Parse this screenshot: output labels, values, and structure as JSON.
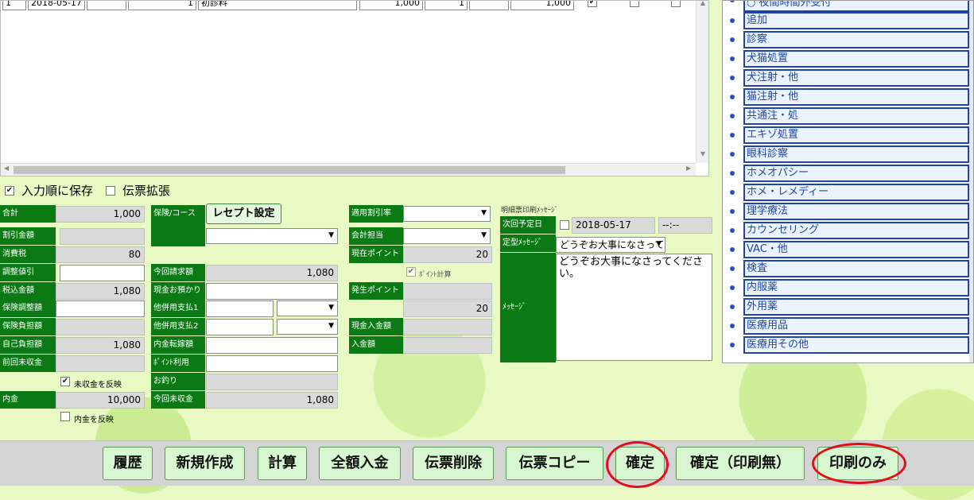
{
  "grid": {
    "row": {
      "no": "1",
      "date": "2018-05-17",
      "code": "",
      "qty": "1",
      "item": "初診料",
      "price": "1,000",
      "count": "1",
      "discount": "",
      "amount": "1,000",
      "check1": true,
      "check2": false,
      "check3": false
    }
  },
  "menu": {
    "top_partial": "○ 夜間時間外受付",
    "items": [
      "追加",
      "診察",
      "犬猫処置",
      "犬注射・他",
      "猫注射・他",
      "共通注・処",
      "エキゾ処置",
      "眼科診察",
      "ホメオパシー",
      "ホメ・レメディー",
      "理学療法",
      "カウンセリング",
      "VAC・他",
      "検査",
      "内服薬",
      "外用薬",
      "医療用品",
      "医療用その他"
    ]
  },
  "options": {
    "save_order_label": "入力順に保存",
    "save_order_checked": true,
    "expand_label": "伝票拡張",
    "expand_checked": false
  },
  "col1": {
    "total_label": "合計",
    "total": "1,000",
    "discount_label": "割引金額",
    "discount": "",
    "tax_label": "消費税",
    "tax": "80",
    "adjust_label": "調整値引",
    "adjust": "",
    "taxin_label": "税込金額",
    "taxin": "1,080",
    "ins_adjust_label": "保険調整額",
    "ins_adjust": "",
    "ins_burden_label": "保険負担額",
    "ins_burden": "",
    "self_label": "自己負担額",
    "self": "1,080",
    "prev_unpaid_label": "前回未収金",
    "prev_unpaid": "",
    "reflect_unpaid_label": "未収金を反映",
    "reflect_unpaid_checked": true,
    "deposit_label": "内金",
    "deposit": "10,000",
    "reflect_deposit_label": "内金を反映",
    "reflect_deposit_checked": false
  },
  "col2": {
    "insurance_label": "保険/コース",
    "receipt_button": "レセプト設定",
    "insurance_select": "",
    "bill_label": "今回請求額",
    "bill": "1,080",
    "cash_label": "現金お預かり",
    "cash": "",
    "other1_label": "他併用支払1",
    "other1": "",
    "other1_type": "",
    "other2_label": "他併用支払2",
    "other2": "",
    "other2_type": "",
    "transfer_label": "内金転嫁額",
    "transfer": "",
    "point_use_label": "ﾎﾟｲﾝﾄ利用",
    "point_use": "",
    "change_label": "お釣り",
    "change": "",
    "unpaid_label": "今回未収金",
    "unpaid": "1,080"
  },
  "col3": {
    "rate_label": "適用割引率",
    "rate": "",
    "staff_label": "会計担当",
    "staff": "",
    "cur_point_label": "現在ポイント",
    "cur_point": "20",
    "calc_point_label": "ﾎﾟｲﾝﾄ計算",
    "calc_point_checked": true,
    "gen_point_label": "発生ポイント",
    "gen_point": "",
    "gen_point_total": "20",
    "cash_in_label": "現金入金額",
    "cash_in": "",
    "in_label": "入金額",
    "in": ""
  },
  "col4": {
    "header": "明細票印刷ﾒｯｾｰｼﾞ",
    "next_label": "次回予定日",
    "next_date": "2018-05-17",
    "next_time": "--:--",
    "preset_label": "定型ﾒｯｾｰｼﾞ",
    "preset_value": "どうぞお大事になさってください。",
    "message_label": "ﾒｯｾｰｼﾞ",
    "message": "どうぞお大事になさってください。"
  },
  "actions": {
    "history": "履歴",
    "new": "新規作成",
    "calc": "計算",
    "full_pay": "全額入金",
    "delete": "伝票削除",
    "copy": "伝票コピー",
    "confirm": "確定",
    "confirm_noprint": "確定（印刷無）",
    "print_only": "印刷のみ"
  }
}
